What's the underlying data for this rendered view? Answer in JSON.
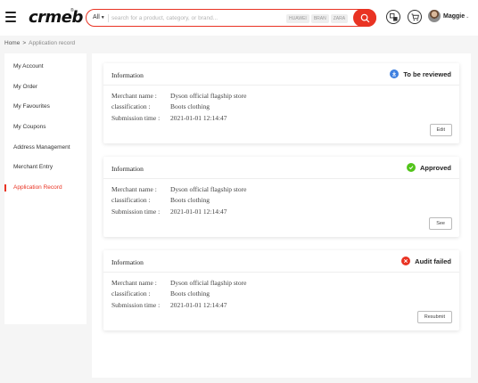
{
  "header": {
    "logo": "crmeb",
    "logo_mark": "®",
    "search": {
      "category": "All",
      "placeholder": "search for a product, category, or brand...",
      "hot_tags": [
        "HUAWEI",
        "BRAN",
        "ZARA"
      ]
    },
    "user": {
      "name": "Maggie"
    }
  },
  "breadcrumb": {
    "home": "Home",
    "separator": ">",
    "current": "Application record"
  },
  "sidebar": {
    "items": [
      {
        "label": "My Account"
      },
      {
        "label": "My Order"
      },
      {
        "label": "My Favourites"
      },
      {
        "label": "My Coupons"
      },
      {
        "label": "Address Management"
      },
      {
        "label": "Merchant Entry"
      },
      {
        "label": "Application Record",
        "active": true
      }
    ]
  },
  "records": [
    {
      "title": "Information",
      "status": "To be reviewed",
      "status_icon": "pending-icon",
      "status_color": "#3d7fe0",
      "fields": [
        {
          "label": "Merchant name :",
          "value": "Dyson official flagship store"
        },
        {
          "label": "classification :",
          "value": "Boots clothing"
        },
        {
          "label": "Submission time :",
          "value": "2021-01-01 12:14:47"
        }
      ],
      "action": "Edit"
    },
    {
      "title": "Information",
      "status": "Approved",
      "status_icon": "check-icon",
      "status_color": "#52c41a",
      "fields": [
        {
          "label": "Merchant name :",
          "value": "Dyson official flagship store"
        },
        {
          "label": "classification :",
          "value": "Boots clothing"
        },
        {
          "label": "Submission time :",
          "value": "2021-01-01 12:14:47"
        }
      ],
      "action": "See"
    },
    {
      "title": "Information",
      "status": "Audit failed",
      "status_icon": "close-icon",
      "status_color": "#e93323",
      "fields": [
        {
          "label": "Merchant name :",
          "value": "Dyson official flagship store"
        },
        {
          "label": "classification :",
          "value": "Boots clothing"
        },
        {
          "label": "Submission time :",
          "value": "2021-01-01 12:14:47"
        }
      ],
      "action": "Resubmit"
    }
  ],
  "colors": {
    "accent": "#e93323",
    "background": "#f5f5f5"
  }
}
